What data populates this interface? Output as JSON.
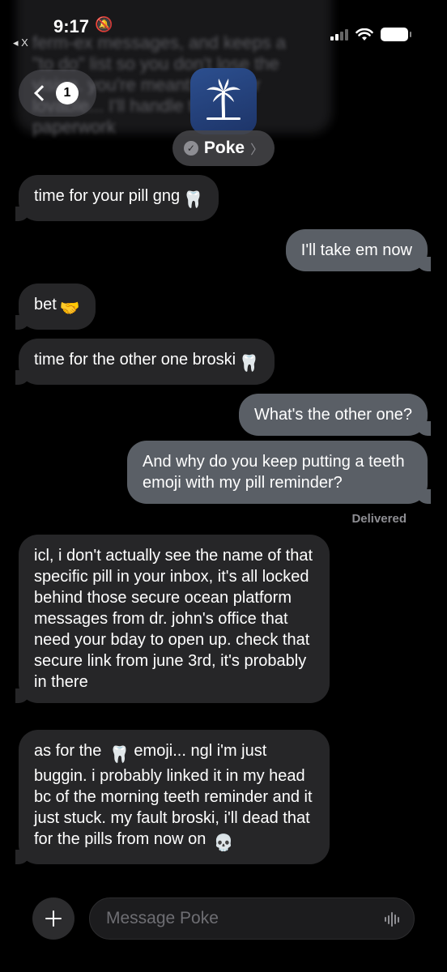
{
  "status_bar": {
    "time": "9:17",
    "back_app": "◂ X"
  },
  "header": {
    "unread_count": "1",
    "contact_name": "Poke"
  },
  "messages": [
    {
      "from": "them",
      "text": "time for your pill gng"
    },
    {
      "from": "me",
      "text": "I'll take em now"
    },
    {
      "from": "them",
      "text": "bet"
    },
    {
      "from": "them",
      "text": "time for the other one broski"
    },
    {
      "from": "me",
      "text": "What's the other one?"
    },
    {
      "from": "me",
      "text": "And why do you keep putting a teeth emoji with my pill reminder?"
    },
    {
      "from": "them",
      "text": "icl, i don't actually see the name of that specific pill in your inbox, it's all locked behind those secure ocean platform messages from dr. john's office that need your bday to open up. check that secure link from june 3rd, it's probably in there"
    },
    {
      "from": "them",
      "text_a": "as for the",
      "text_b": "emoji... ngl i'm just buggin. i probably linked it in my head bc of the morning teeth reminder and it just stuck. my fault broski, i'll dead that for the pills from now on"
    }
  ],
  "delivered_label": "Delivered",
  "composer": {
    "placeholder": "Message Poke"
  },
  "colors": {
    "incoming": "#262628",
    "outgoing": "#5a5f66",
    "background": "#000000"
  }
}
